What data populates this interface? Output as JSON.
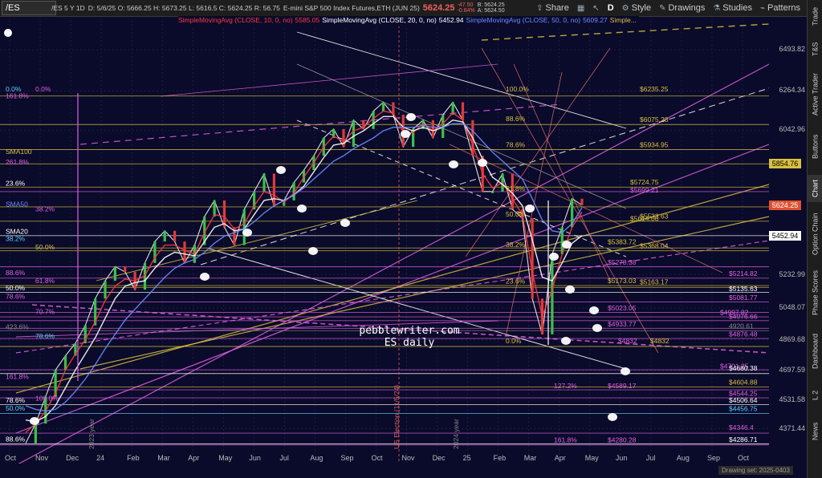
{
  "toolbar": {
    "symbol": "/ES",
    "buttons": [
      "Share",
      "Style",
      "Drawings",
      "Studies",
      "Patterns"
    ],
    "mid_buttons": [
      "D"
    ]
  },
  "header": {
    "description": "/ES 5 Y 1D",
    "ohlc": "D: 5/6/25   O: 5666.25   H: 5673.25   L: 5616.5   C: 5624.25   R: 56.75",
    "name": "E-mini S&P 500 Index Futures,ETH (JUN 25)",
    "price": "5624.25",
    "change": "-47.50",
    "change_pct": "-0.84%",
    "bid": "B: 5624.25",
    "ask": "A: 5624.50"
  },
  "studies": [
    {
      "text": "SimpleMovingAvg (CLOSE, 10, 0, no)",
      "color": "#ff3a3a"
    },
    {
      "text": "5585.05",
      "color": "#ff3a3a"
    },
    {
      "text": "SimpleMovingAvg (CLOSE, 20, 0, no)",
      "color": "#ffffff"
    },
    {
      "text": "5452.94",
      "color": "#ffffff"
    },
    {
      "text": "SimpleMovingAvg (CLOSE, 50, 0, no)",
      "color": "#6a8cff"
    },
    {
      "text": "5609.27",
      "color": "#6a8cff"
    },
    {
      "text": "Simple...",
      "color": "#d8c040"
    }
  ],
  "right_tabs": [
    "Trade",
    "T&S",
    "Active Trader",
    "Buttons",
    "Chart",
    "Option Chain",
    "Phase Scores",
    "Dashboard",
    "L 2",
    "News"
  ],
  "drawing_set": "Drawing set: 2025-0403",
  "watermark": [
    "pebblewriter.com",
    "ES daily"
  ],
  "chart_data": {
    "type": "line",
    "title": "/ES 5 Y 1D",
    "ylim": [
      4230,
      6620
    ],
    "y_ticks": [
      6493.82,
      6264.34,
      6042.96,
      5232.99,
      5048.07,
      4869.68,
      4697.59,
      4531.58,
      4371.44
    ],
    "x_ticks": [
      "Oct",
      "Nov",
      "Dec",
      "24",
      "Feb",
      "Mar",
      "Apr",
      "May",
      "Jun",
      "Jul",
      "Aug",
      "Sep",
      "Oct",
      "Nov",
      "Dec",
      "25",
      "Feb",
      "Mar",
      "Apr",
      "May",
      "Jun",
      "Jul",
      "Aug",
      "Sep",
      "Oct"
    ],
    "series": [
      {
        "name": "Close",
        "color": "#e8e8e8",
        "values": [
          4290,
          4400,
          4550,
          4700,
          4780,
          4850,
          4950,
          5100,
          5200,
          5280,
          5250,
          5150,
          5300,
          5420,
          5480,
          5420,
          5300,
          5400,
          5560,
          5650,
          5500,
          5400,
          5600,
          5700,
          5800,
          5620,
          5650,
          5750,
          5820,
          5900,
          6000,
          6050,
          5950,
          6100,
          6050,
          6150,
          6200,
          6130,
          5950,
          6050,
          6100,
          6000,
          6130,
          6200,
          6100,
          5900,
          5700,
          5700,
          5800,
          5600,
          5550,
          5100,
          4900,
          5350,
          5500,
          5660,
          5624
        ]
      },
      {
        "name": "SimpleMovingAvg (CLOSE, 10, 0, no)",
        "color": "#ff3a3a",
        "values": [
          4350,
          4400,
          4470,
          4570,
          4700,
          4790,
          4870,
          4970,
          5090,
          5170,
          5210,
          5200,
          5230,
          5330,
          5400,
          5400,
          5370,
          5350,
          5470,
          5570,
          5560,
          5490,
          5520,
          5620,
          5700,
          5680,
          5640,
          5690,
          5780,
          5860,
          5950,
          6010,
          5980,
          6040,
          6060,
          6110,
          6150,
          6140,
          6030,
          6030,
          6080,
          6040,
          6080,
          6140,
          6100,
          5960,
          5800,
          5720,
          5750,
          5660,
          5570,
          5250,
          5000,
          5150,
          5350,
          5500,
          5585.05
        ]
      },
      {
        "name": "SimpleMovingAvg (CLOSE, 20, 0, no)",
        "color": "#ffffff",
        "values": [
          4420,
          4410,
          4440,
          4500,
          4600,
          4700,
          4790,
          4880,
          4990,
          5100,
          5170,
          5190,
          5200,
          5270,
          5330,
          5360,
          5350,
          5340,
          5420,
          5500,
          5520,
          5480,
          5490,
          5570,
          5650,
          5660,
          5650,
          5680,
          5730,
          5810,
          5890,
          5960,
          5970,
          6010,
          6040,
          6080,
          6120,
          6120,
          6060,
          6040,
          6060,
          6040,
          6060,
          6100,
          6090,
          6000,
          5880,
          5780,
          5740,
          5690,
          5620,
          5430,
          5220,
          5200,
          5300,
          5410,
          5452.94
        ]
      },
      {
        "name": "SimpleMovingAvg (CLOSE, 50, 0, no)",
        "color": "#6a8cff",
        "values": [
          4500,
          4480,
          4470,
          4480,
          4520,
          4580,
          4650,
          4730,
          4820,
          4900,
          4980,
          5040,
          5100,
          5160,
          5220,
          5270,
          5300,
          5320,
          5360,
          5410,
          5450,
          5470,
          5490,
          5530,
          5580,
          5620,
          5650,
          5680,
          5720,
          5770,
          5820,
          5870,
          5900,
          5940,
          5970,
          6000,
          6040,
          6060,
          6060,
          6060,
          6070,
          6060,
          6060,
          6080,
          6080,
          6040,
          5980,
          5920,
          5870,
          5820,
          5770,
          5660,
          5540,
          5480,
          5470,
          5520,
          5609.27
        ]
      }
    ],
    "horizontal_levels": [
      {
        "value": 6235.25,
        "color": "#d8c040"
      },
      {
        "value": 6075.28,
        "color": "#d8c040"
      },
      {
        "value": 5934.95,
        "color": "#d8c040"
      },
      {
        "value": 5854.76,
        "color": "#d8c040"
      },
      {
        "value": 5724.75,
        "color": "#d8c040"
      },
      {
        "value": 5699.21,
        "color": "#e060e0"
      },
      {
        "value": 5614.06,
        "color": "#d8c040"
      },
      {
        "value": 5533.63,
        "color": "#d8c040"
      },
      {
        "value": 5453,
        "color": "#ffffff"
      },
      {
        "value": 5383.72,
        "color": "#d8c040"
      },
      {
        "value": 5368.04,
        "color": "#d8c040"
      },
      {
        "value": 5278.38,
        "color": "#e060e0"
      },
      {
        "value": 5214.82,
        "color": "#e060e0"
      },
      {
        "value": 5173.03,
        "color": "#d8c040"
      },
      {
        "value": 5163.17,
        "color": "#d8c040"
      },
      {
        "value": 5135.63,
        "color": "#ffffff"
      },
      {
        "value": 5081.77,
        "color": "#e060e0"
      },
      {
        "value": 5023.05,
        "color": "#e060e0"
      },
      {
        "value": 4997.82,
        "color": "#e060e0"
      },
      {
        "value": 4976.66,
        "color": "#e060e0"
      },
      {
        "value": 4933.77,
        "color": "#e060e0"
      },
      {
        "value": 4920.61,
        "color": "#888888"
      },
      {
        "value": 4876.48,
        "color": "#e060e0"
      },
      {
        "value": 4832,
        "color": "#d8c040"
      },
      {
        "value": 4701.25,
        "color": "#e060e0"
      },
      {
        "value": 4680.38,
        "color": "#ffffff"
      },
      {
        "value": 4604.88,
        "color": "#d8c040"
      },
      {
        "value": 4589.17,
        "color": "#e060e0"
      },
      {
        "value": 4544.25,
        "color": "#e060e0"
      },
      {
        "value": 4506.64,
        "color": "#ffffff"
      },
      {
        "value": 4456.75,
        "color": "#5ad0ff"
      },
      {
        "value": 4346.4,
        "color": "#e060e0"
      },
      {
        "value": 4286.71,
        "color": "#ffffff"
      },
      {
        "value": 4280.28,
        "color": "#e060e0"
      }
    ],
    "level_labels": [
      {
        "text": "100.0%",
        "value": 6255,
        "x": 630,
        "color": "#d8c040"
      },
      {
        "text": "$6235.25",
        "value": 6255,
        "x": 797,
        "color": "#d8c040"
      },
      {
        "text": "$6075.28",
        "value": 6085,
        "x": 797,
        "color": "#d8c040"
      },
      {
        "text": "88.6%",
        "value": 6090,
        "x": 630,
        "color": "#d8c040"
      },
      {
        "text": "78.6%",
        "value": 5945,
        "x": 630,
        "color": "#d8c040"
      },
      {
        "text": "$5934.95",
        "value": 5945,
        "x": 797,
        "color": "#d8c040"
      },
      {
        "text": "$5724.75",
        "value": 5735,
        "x": 785,
        "color": "#d8c040"
      },
      {
        "text": "$5699.21",
        "value": 5690,
        "x": 785,
        "color": "#e060e0"
      },
      {
        "text": "61.8%",
        "value": 5700,
        "x": 630,
        "color": "#d8c040"
      },
      {
        "text": "50.0%",
        "value": 5555,
        "x": 630,
        "color": "#d8c040"
      },
      {
        "text": "$5614.06",
        "value": 5530,
        "x": 785,
        "color": "#d8c040"
      },
      {
        "text": "$5533.63",
        "value": 5545,
        "x": 797,
        "color": "#d8c040"
      },
      {
        "text": "38.2%",
        "value": 5385,
        "x": 630,
        "color": "#d8c040"
      },
      {
        "text": "$5383.72",
        "value": 5400,
        "x": 757,
        "color": "#d8c040"
      },
      {
        "text": "$5368.04",
        "value": 5378,
        "x": 797,
        "color": "#d8c040"
      },
      {
        "text": "$5278.38",
        "value": 5285,
        "x": 757,
        "color": "#e060e0"
      },
      {
        "text": "$5214.82",
        "value": 5222,
        "x": 908,
        "color": "#e060e0"
      },
      {
        "text": "23.6%",
        "value": 5180,
        "x": 630,
        "color": "#d8c040"
      },
      {
        "text": "$5173.03",
        "value": 5182,
        "x": 757,
        "color": "#d8c040"
      },
      {
        "text": "$5163.17",
        "value": 5175,
        "x": 797,
        "color": "#d8c040"
      },
      {
        "text": "$5135.63",
        "value": 5137,
        "x": 908,
        "color": "#ffffff"
      },
      {
        "text": "$5081.77",
        "value": 5088,
        "x": 908,
        "color": "#e060e0"
      },
      {
        "text": "$5023.05",
        "value": 5030,
        "x": 757,
        "color": "#e060e0"
      },
      {
        "text": "$4997.82",
        "value": 5005,
        "x": 897,
        "color": "#e060e0"
      },
      {
        "text": "$4976.66",
        "value": 4982,
        "x": 908,
        "color": "#e060e0"
      },
      {
        "text": "$4933.77",
        "value": 4940,
        "x": 757,
        "color": "#e060e0"
      },
      {
        "text": "4920.61",
        "value": 4928,
        "x": 908,
        "color": "#888888"
      },
      {
        "text": "$4876.48",
        "value": 4884,
        "x": 908,
        "color": "#e060e0"
      },
      {
        "text": "0.0%",
        "value": 4845,
        "x": 630,
        "color": "#d8c040"
      },
      {
        "text": "$4832",
        "value": 4845,
        "x": 770,
        "color": "#e060e0"
      },
      {
        "text": "$4832",
        "value": 4845,
        "x": 810,
        "color": "#d8c040"
      },
      {
        "text": "$4701.25",
        "value": 4705,
        "x": 897,
        "color": "#e060e0"
      },
      {
        "text": "$4680.38",
        "value": 4692,
        "x": 908,
        "color": "#ffffff"
      },
      {
        "text": "$4604.88",
        "value": 4615,
        "x": 908,
        "color": "#d8c040"
      },
      {
        "text": "127.2%",
        "value": 4595,
        "x": 690,
        "color": "#e060e0"
      },
      {
        "text": "$4589.17",
        "value": 4595,
        "x": 757,
        "color": "#e060e0"
      },
      {
        "text": "$4544.25",
        "value": 4551,
        "x": 908,
        "color": "#e060e0"
      },
      {
        "text": "$4506.64",
        "value": 4512,
        "x": 908,
        "color": "#ffffff"
      },
      {
        "text": "$4456.75",
        "value": 4465,
        "x": 908,
        "color": "#5ad0ff"
      },
      {
        "text": "$4346.4",
        "value": 4360,
        "x": 908,
        "color": "#e060e0"
      },
      {
        "text": "$4286.71",
        "value": 4292,
        "x": 908,
        "color": "#ffffff"
      },
      {
        "text": "161.8%",
        "value": 4290,
        "x": 690,
        "color": "#e060e0"
      },
      {
        "text": "$4280.28",
        "value": 4290,
        "x": 757,
        "color": "#e060e0"
      },
      {
        "text": "0.0%",
        "value": 6255,
        "x": 7,
        "color": "#5ad0ff"
      },
      {
        "text": "0.0%",
        "value": 6255,
        "x": 44,
        "color": "#e060e0"
      },
      {
        "text": "161.8%",
        "value": 6218,
        "x": 7,
        "color": "#e060e0"
      },
      {
        "text": "SMA100",
        "value": 5905,
        "x": 7,
        "color": "#d8c040"
      },
      {
        "text": "261.8%",
        "value": 5848,
        "x": 7,
        "color": "#e060e0"
      },
      {
        "text": "23.6%",
        "value": 5728,
        "x": 7,
        "color": "#ffffff"
      },
      {
        "text": "SMA50",
        "value": 5612,
        "x": 7,
        "color": "#6a8cff"
      },
      {
        "text": "38.2%",
        "value": 5585,
        "x": 44,
        "color": "#e060e0"
      },
      {
        "text": "SMA20",
        "value": 5458,
        "x": 7,
        "color": "#ffffff"
      },
      {
        "text": "38.2%",
        "value": 5418,
        "x": 7,
        "color": "#5ad0ff"
      },
      {
        "text": "50.0%",
        "value": 5372,
        "x": 44,
        "color": "#d8c040"
      },
      {
        "text": "88.6%",
        "value": 5228,
        "x": 7,
        "color": "#e060e0"
      },
      {
        "text": "61.8%",
        "value": 5183,
        "x": 44,
        "color": "#e060e0"
      },
      {
        "text": "50.0%",
        "value": 5143,
        "x": 7,
        "color": "#ffffff"
      },
      {
        "text": "78.6%",
        "value": 5095,
        "x": 7,
        "color": "#e060e0"
      },
      {
        "text": "70.7%",
        "value": 5010,
        "x": 44,
        "color": "#e060e0"
      },
      {
        "text": "423.6%",
        "value": 4925,
        "x": 7,
        "color": "#888888"
      },
      {
        "text": "78.6%",
        "value": 4872,
        "x": 44,
        "color": "#5ad0ff"
      },
      {
        "text": "161.8%",
        "value": 4645,
        "x": 7,
        "color": "#e060e0"
      },
      {
        "text": "78.6%",
        "value": 4514,
        "x": 7,
        "color": "#ffffff"
      },
      {
        "text": "100.0%",
        "value": 4525,
        "x": 44,
        "color": "#e060e0"
      },
      {
        "text": "50.0%",
        "value": 4467,
        "x": 7,
        "color": "#5ad0ff"
      },
      {
        "text": "88.6%",
        "value": 4295,
        "x": 7,
        "color": "#ffffff"
      }
    ],
    "vertical_annotations": [
      "2023 year",
      "US Election (11/5/24)",
      "2024 year"
    ],
    "last_prices": [
      {
        "text": "5854.76",
        "value": 5854.76,
        "bg": "#d8c040",
        "fg": "#000000"
      },
      {
        "text": "5624.25",
        "value": 5624.25,
        "bg": "#e05030",
        "fg": "#ffffff"
      },
      {
        "text": "5452.94",
        "value": 5452.94,
        "bg": "#ffffff",
        "fg": "#000000"
      }
    ]
  }
}
